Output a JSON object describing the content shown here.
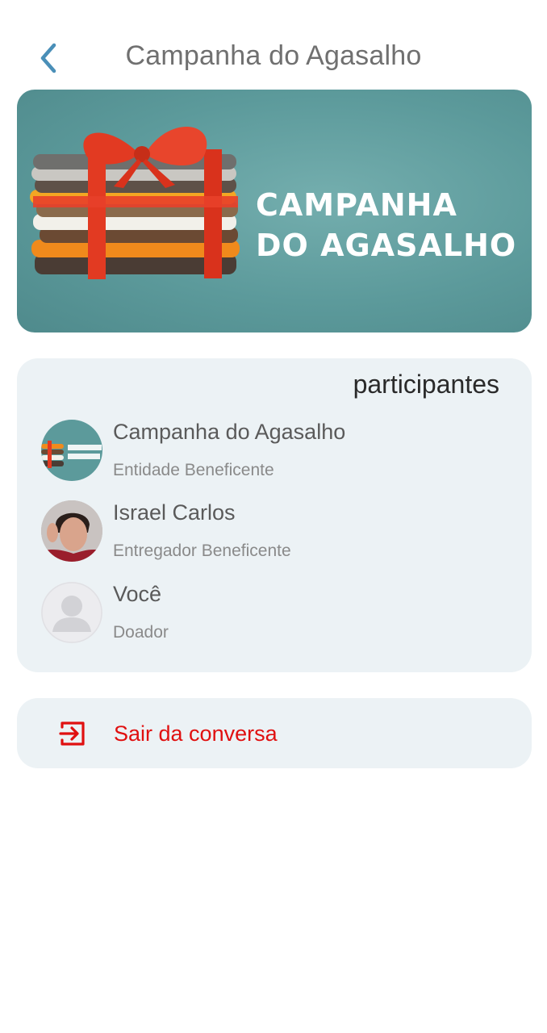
{
  "header": {
    "back_icon": "chevron-left-icon",
    "title": "Campanha do Agasalho"
  },
  "banner": {
    "line1": "CAMPANHA",
    "line2": "DO AGASALHO",
    "colors": {
      "background": "#5c9a9b",
      "ribbon": "#e23a22"
    }
  },
  "participants": {
    "heading": "participantes",
    "items": [
      {
        "name": "Campanha do Agasalho",
        "role": "Entidade Beneficente",
        "avatar": "campaign-logo-avatar"
      },
      {
        "name": "Israel Carlos",
        "role": "Entregador Beneficente",
        "avatar": "user-photo-avatar"
      },
      {
        "name": "Você",
        "role": "Doador",
        "avatar": "default-person-avatar"
      }
    ]
  },
  "leave": {
    "icon": "exit-icon",
    "label": "Sair da conversa",
    "color": "#e01010"
  },
  "colors": {
    "accent": "#4a8fb8",
    "card": "#ecf2f5"
  }
}
